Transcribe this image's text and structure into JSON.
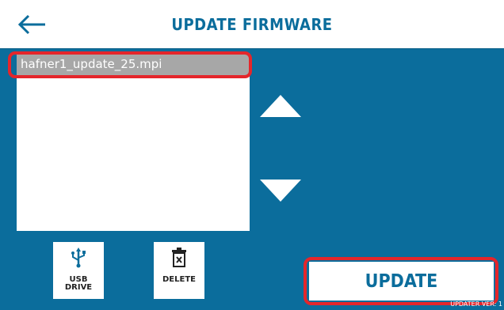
{
  "header": {
    "title": "UPDATE FIRMWARE",
    "back_icon": "arrow-left-icon"
  },
  "file_list": {
    "files": [
      "hafner1_update_25.mpi"
    ],
    "selected_index": 0
  },
  "scroll": {
    "up_icon": "triangle-up-icon",
    "down_icon": "triangle-down-icon"
  },
  "tools": {
    "usb_label_line1": "USB",
    "usb_label_line2": "DRIVE",
    "usb_icon": "usb-icon",
    "delete_label": "DELETE",
    "delete_icon": "trash-icon"
  },
  "update_label": "UPDATE",
  "version": "UPDATER VER: 1",
  "colors": {
    "background": "#0b6d9c",
    "header": "#ffffff",
    "selected_row": "#a7a7a7",
    "highlight": "#e4262b"
  }
}
